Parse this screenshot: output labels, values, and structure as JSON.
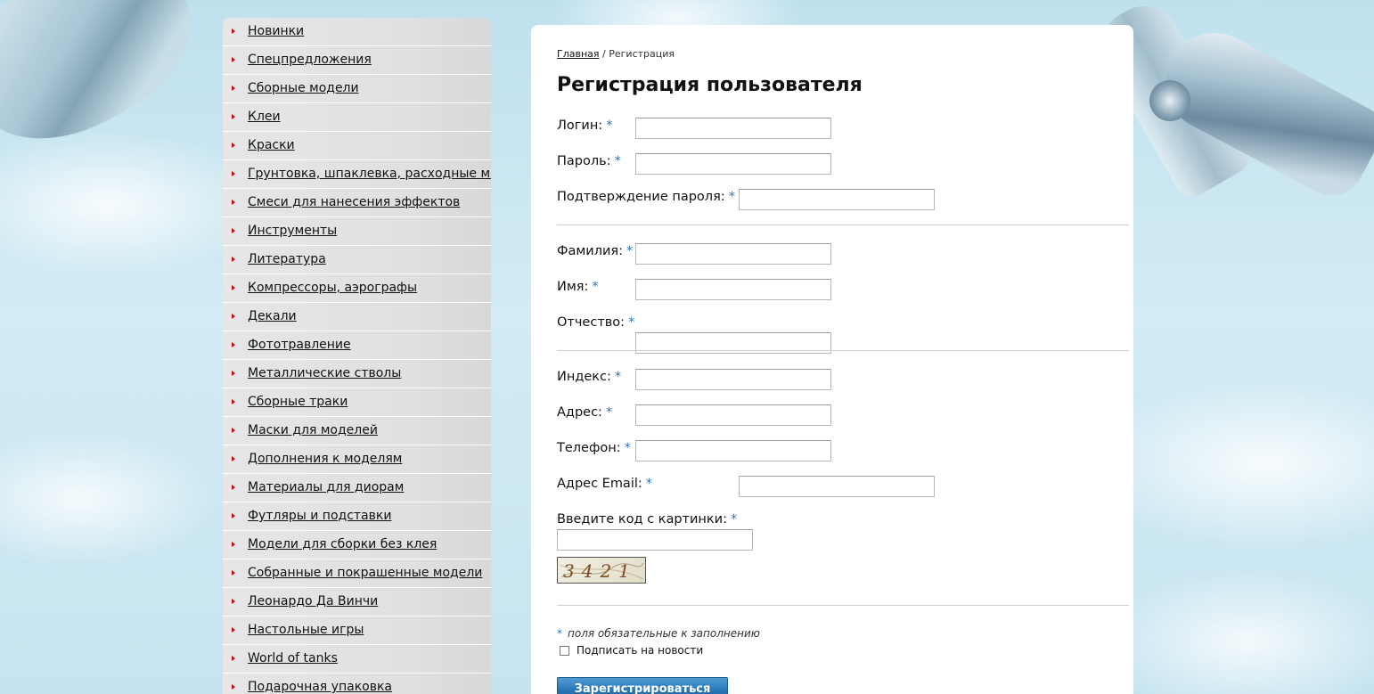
{
  "sidebar": {
    "items": [
      {
        "label": "Новинки"
      },
      {
        "label": "Спецпредложения"
      },
      {
        "label": "Сборные модели"
      },
      {
        "label": "Клеи"
      },
      {
        "label": "Краски"
      },
      {
        "label": "Грунтовка, шпаклевка, расходные мат"
      },
      {
        "label": "Смеси для нанесения эффектов"
      },
      {
        "label": "Инструменты"
      },
      {
        "label": "Литература"
      },
      {
        "label": "Компрессоры, аэрографы"
      },
      {
        "label": "Декали"
      },
      {
        "label": "Фототравление"
      },
      {
        "label": "Металлические стволы"
      },
      {
        "label": "Сборные траки"
      },
      {
        "label": "Маски для моделей"
      },
      {
        "label": "Дополнения к моделям"
      },
      {
        "label": "Материалы для диорам"
      },
      {
        "label": "Футляры и подставки"
      },
      {
        "label": "Модели для сборки без клея"
      },
      {
        "label": "Собранные и покрашенные модели"
      },
      {
        "label": "Леонардо Да Винчи"
      },
      {
        "label": "Настольные игры"
      },
      {
        "label": "World of tanks"
      },
      {
        "label": "Подарочная упаковка"
      }
    ]
  },
  "breadcrumb": {
    "home": "Главная",
    "separator": "/",
    "current": "Регистрация"
  },
  "page": {
    "title": "Регистрация пользователя"
  },
  "form": {
    "required_mark": "*",
    "login_label": "Логин:",
    "login_value": "",
    "password_label": "Пароль:",
    "password_value": "",
    "password_confirm_label": "Подтверждение пароля:",
    "password_confirm_value": "",
    "lastname_label": "Фамилия:",
    "lastname_value": "",
    "firstname_label": "Имя:",
    "firstname_value": "",
    "middlename_label": "Отчество:",
    "middlename_value": "",
    "zip_label": "Индекс:",
    "zip_value": "",
    "address_label": "Адрес:",
    "address_value": "",
    "phone_label": "Телефон:",
    "phone_value": "",
    "email_label": "Адрес Email:",
    "email_value": "",
    "captcha_label": "Введите код с картинки:",
    "captcha_value": "",
    "captcha_code": "3421",
    "required_note": "поля обязательные к заполнению",
    "subscribe_label": "Подписать на новости",
    "subscribe_checked": false,
    "submit_label": "Зарегистрироваться"
  },
  "colors": {
    "required_mark": "#2b76b6",
    "bullet": "#c0101a",
    "submit": "#2a78b8"
  }
}
